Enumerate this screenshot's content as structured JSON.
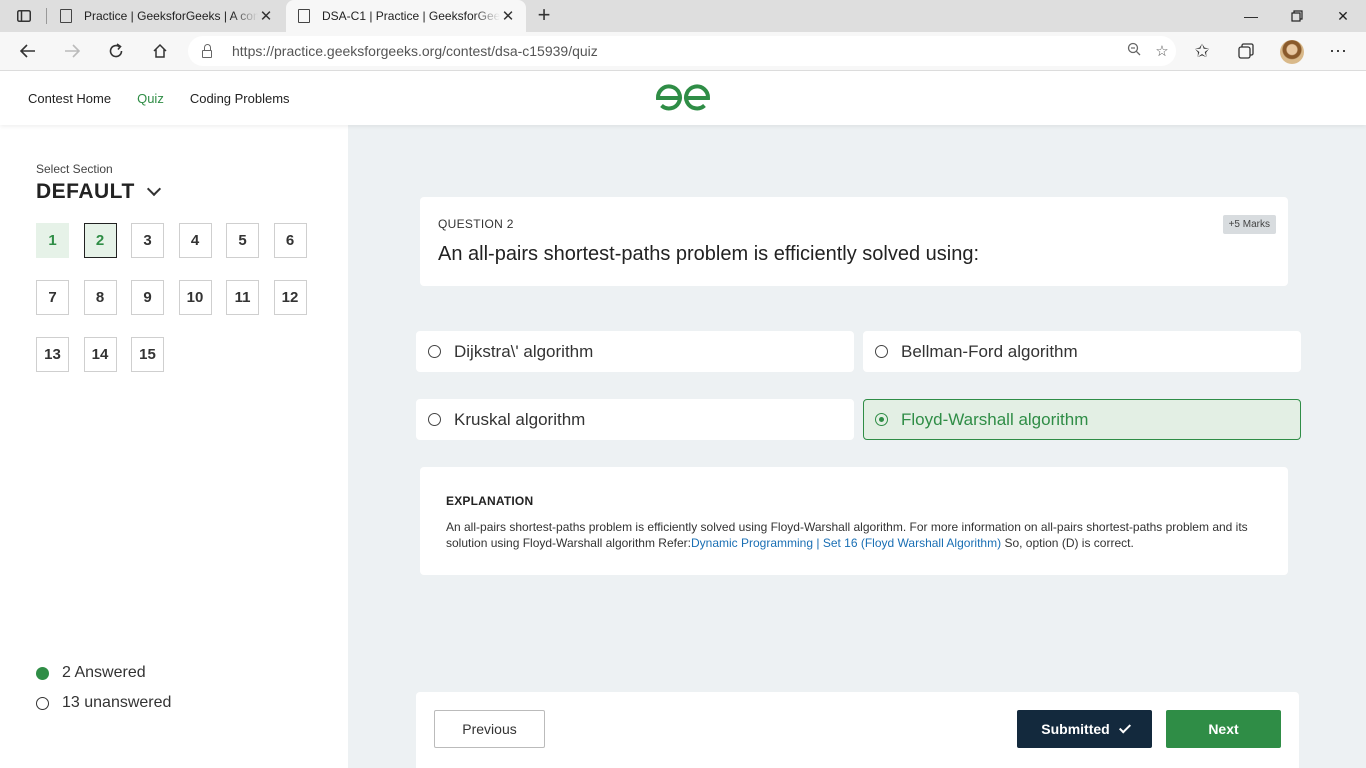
{
  "browser": {
    "tabs": [
      {
        "title": "Practice | GeeksforGeeks | A com",
        "active": false
      },
      {
        "title": "DSA-C1 | Practice | GeeksforGeeks",
        "active": true
      }
    ],
    "url": "https://practice.geeksforgeeks.org/contest/dsa-c15939/quiz"
  },
  "header": {
    "nav": [
      "Contest Home",
      "Quiz",
      "Coding Problems"
    ],
    "active_nav": "Quiz",
    "brand_color": "#2f8d46"
  },
  "sidebar": {
    "section_label": "Select Section",
    "section_value": "DEFAULT",
    "questions": [
      "1",
      "2",
      "3",
      "4",
      "5",
      "6",
      "7",
      "8",
      "9",
      "10",
      "11",
      "12",
      "13",
      "14",
      "15"
    ],
    "answered": [
      "1",
      "2"
    ],
    "current": "2",
    "answered_text": "2 Answered",
    "unanswered_text": "13 unanswered"
  },
  "question": {
    "number_label": "QUESTION 2",
    "marks": "+5 Marks",
    "text": "An all-pairs shortest-paths problem is efficiently solved using:",
    "options": [
      "Dijkstra\\' algorithm",
      "Bellman-Ford algorithm",
      "Kruskal algorithm",
      "Floyd-Warshall algorithm"
    ],
    "selected_index": 3
  },
  "explanation": {
    "title": "EXPLANATION",
    "text_before": "An all-pairs shortest-paths problem is efficiently solved using Floyd-Warshall algorithm. For more information on all-pairs shortest-paths problem and its solution using Floyd-Warshall algorithm Refer:",
    "link_text": "Dynamic Programming | Set 16 (Floyd Warshall Algorithm)",
    "text_after": " So, option (D) is correct."
  },
  "footer": {
    "previous_label": "Previous",
    "submitted_label": "Submitted",
    "next_label": "Next"
  }
}
